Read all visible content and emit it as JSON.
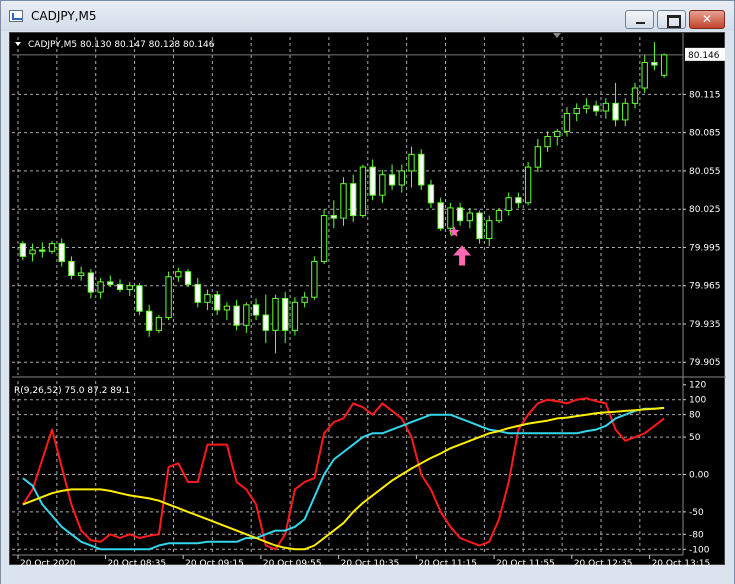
{
  "window": {
    "title": "CADJPY,M5",
    "close_glyph": "✕"
  },
  "chart_header": "CADJPY,M5  80.130 80.147 80.128 80.146",
  "indicator_header": "R(9,26,52) 75.0 87.2 89.1",
  "price_badge": "80.146",
  "colors": {
    "background": "#000000",
    "bull": "#66ff33",
    "bear": "#66ff33",
    "red_line": "#ff1a1a",
    "cyan_line": "#33d6ea",
    "yellow_line": "#ffee00",
    "marker": "#ff69b4"
  },
  "chart_data": [
    {
      "type": "candlestick",
      "symbol": "CADJPY",
      "timeframe": "M5",
      "ylim": [
        79.895,
        80.16
      ],
      "y_ticks": [
        "80.115",
        "80.085",
        "80.055",
        "80.025",
        "79.995",
        "79.965",
        "79.935",
        "79.905"
      ],
      "last_price": "80.146",
      "ohlc_header": {
        "open": 80.13,
        "high": 80.147,
        "low": 80.128,
        "close": 80.146
      },
      "candles": [
        [
          79.998,
          80.0,
          79.985,
          79.988
        ],
        [
          79.99,
          79.998,
          79.984,
          79.993
        ],
        [
          79.993,
          79.999,
          79.987,
          79.992
        ],
        [
          79.992,
          80.0,
          79.99,
          79.998
        ],
        [
          79.998,
          80.002,
          79.98,
          79.984
        ],
        [
          79.984,
          79.988,
          79.97,
          79.973
        ],
        [
          79.973,
          79.98,
          79.969,
          79.975
        ],
        [
          79.975,
          79.978,
          79.955,
          79.96
        ],
        [
          79.96,
          79.971,
          79.955,
          79.968
        ],
        [
          79.968,
          79.973,
          79.964,
          79.966
        ],
        [
          79.966,
          79.97,
          79.96,
          79.962
        ],
        [
          79.962,
          79.968,
          79.957,
          79.965
        ],
        [
          79.965,
          79.967,
          79.942,
          79.945
        ],
        [
          79.945,
          79.95,
          79.925,
          79.93
        ],
        [
          79.93,
          79.942,
          79.928,
          79.94
        ],
        [
          79.94,
          79.976,
          79.938,
          79.972
        ],
        [
          79.972,
          79.979,
          79.968,
          79.976
        ],
        [
          79.976,
          79.978,
          79.964,
          79.966
        ],
        [
          79.966,
          79.971,
          79.948,
          79.952
        ],
        [
          79.952,
          79.962,
          79.946,
          79.958
        ],
        [
          79.958,
          79.961,
          79.942,
          79.946
        ],
        [
          79.946,
          79.952,
          79.938,
          79.949
        ],
        [
          79.949,
          79.954,
          79.93,
          79.934
        ],
        [
          79.934,
          79.952,
          79.928,
          79.95
        ],
        [
          79.95,
          79.955,
          79.938,
          79.942
        ],
        [
          79.942,
          79.958,
          79.92,
          79.93
        ],
        [
          79.93,
          79.958,
          79.912,
          79.955
        ],
        [
          79.955,
          79.96,
          79.92,
          79.93
        ],
        [
          79.93,
          79.956,
          79.926,
          79.952
        ],
        [
          79.952,
          79.96,
          79.948,
          79.956
        ],
        [
          79.956,
          79.988,
          79.954,
          79.984
        ],
        [
          79.984,
          80.025,
          79.982,
          80.02
        ],
        [
          80.02,
          80.032,
          80.01,
          80.018
        ],
        [
          80.018,
          80.05,
          80.012,
          80.045
        ],
        [
          80.045,
          80.052,
          80.015,
          80.02
        ],
        [
          80.02,
          80.06,
          80.018,
          80.058
        ],
        [
          80.058,
          80.064,
          80.032,
          80.036
        ],
        [
          80.036,
          80.056,
          80.03,
          80.052
        ],
        [
          80.052,
          80.06,
          80.04,
          80.044
        ],
        [
          80.044,
          80.06,
          80.038,
          80.055
        ],
        [
          80.055,
          80.074,
          80.042,
          80.068
        ],
        [
          80.068,
          80.072,
          80.04,
          80.044
        ],
        [
          80.044,
          80.048,
          80.026,
          80.03
        ],
        [
          80.03,
          80.034,
          80.008,
          80.01
        ],
        [
          80.01,
          80.03,
          80.005,
          80.026
        ],
        [
          80.026,
          80.03,
          80.012,
          80.016
        ],
        [
          80.016,
          80.026,
          80.01,
          80.022
        ],
        [
          80.022,
          80.024,
          79.998,
          80.002
        ],
        [
          80.002,
          80.02,
          79.996,
          80.016
        ],
        [
          80.016,
          80.026,
          80.014,
          80.024
        ],
        [
          80.024,
          80.038,
          80.02,
          80.034
        ],
        [
          80.034,
          80.038,
          80.026,
          80.03
        ],
        [
          80.03,
          80.062,
          80.028,
          80.058
        ],
        [
          80.058,
          80.08,
          80.054,
          80.074
        ],
        [
          80.074,
          80.086,
          80.07,
          80.082
        ],
        [
          80.082,
          80.088,
          80.075,
          80.086
        ],
        [
          80.086,
          80.105,
          80.082,
          80.1
        ],
        [
          80.1,
          80.108,
          80.094,
          80.104
        ],
        [
          80.104,
          80.112,
          80.1,
          80.106
        ],
        [
          80.106,
          80.11,
          80.098,
          80.102
        ],
        [
          80.102,
          80.112,
          80.096,
          80.108
        ],
        [
          80.108,
          80.124,
          80.09,
          80.095
        ],
        [
          80.095,
          80.112,
          80.09,
          80.108
        ],
        [
          80.108,
          80.124,
          80.104,
          80.12
        ],
        [
          80.12,
          80.146,
          80.116,
          80.14
        ],
        [
          80.14,
          80.156,
          80.134,
          80.138
        ],
        [
          80.13,
          80.147,
          80.128,
          80.146
        ]
      ],
      "markers": [
        {
          "type": "star",
          "candle_index": 45,
          "price": 80.004
        },
        {
          "type": "up-arrow",
          "candle_index": 45,
          "price": 79.995
        }
      ]
    },
    {
      "type": "line",
      "name": "R(9,26,52)",
      "ylim": [
        -105,
        125
      ],
      "y_ticks": [
        120,
        100,
        80,
        50,
        0,
        -50,
        -80,
        -100
      ],
      "y_tick_labels": [
        "120",
        "100",
        "80",
        "50",
        "0.00",
        "-50",
        "-80",
        "-100"
      ],
      "x_tick_labels": [
        "20 Oct 2020",
        "20 Oct 08:35",
        "20 Oct 09:15",
        "20 Oct 09:55",
        "20 Oct 10:35",
        "20 Oct 11:15",
        "20 Oct 11:55",
        "20 Oct 12:35",
        "20 Oct 13:15"
      ],
      "x_tick_candle_index": [
        0,
        9,
        17,
        25,
        33,
        41,
        49,
        57,
        65
      ],
      "current_values": [
        "75.0",
        "87.2",
        "89.1"
      ],
      "series": [
        {
          "color": "red",
          "values": [
            -40,
            -20,
            20,
            60,
            10,
            -40,
            -75,
            -88,
            -90,
            -80,
            -85,
            -80,
            -85,
            -82,
            -80,
            10,
            15,
            -10,
            -10,
            40,
            40,
            40,
            -10,
            -20,
            -40,
            -95,
            -100,
            -80,
            -20,
            -10,
            -5,
            55,
            70,
            75,
            95,
            90,
            80,
            95,
            85,
            75,
            50,
            0,
            -20,
            -50,
            -70,
            -85,
            -90,
            -95,
            -90,
            -60,
            -10,
            60,
            80,
            95,
            100,
            98,
            95,
            100,
            102,
            98,
            95,
            60,
            45,
            50,
            55,
            65,
            75
          ]
        },
        {
          "color": "cyan",
          "values": [
            -5,
            -15,
            -40,
            -55,
            -70,
            -80,
            -90,
            -95,
            -100,
            -100,
            -100,
            -100,
            -100,
            -100,
            -95,
            -92,
            -92,
            -92,
            -92,
            -90,
            -90,
            -90,
            -90,
            -85,
            -85,
            -80,
            -75,
            -75,
            -70,
            -60,
            -30,
            0,
            20,
            30,
            40,
            50,
            55,
            55,
            60,
            65,
            70,
            75,
            80,
            80,
            80,
            75,
            70,
            65,
            60,
            58,
            55,
            55,
            55,
            55,
            55,
            55,
            55,
            55,
            58,
            60,
            65,
            75,
            80,
            85,
            88,
            88,
            89
          ]
        },
        {
          "color": "yellow",
          "values": [
            -40,
            -35,
            -30,
            -25,
            -22,
            -20,
            -20,
            -20,
            -20,
            -22,
            -25,
            -28,
            -30,
            -32,
            -35,
            -40,
            -45,
            -50,
            -55,
            -60,
            -65,
            -70,
            -75,
            -80,
            -85,
            -90,
            -95,
            -98,
            -100,
            -100,
            -95,
            -85,
            -75,
            -65,
            -50,
            -38,
            -28,
            -18,
            -8,
            0,
            8,
            15,
            22,
            28,
            35,
            40,
            45,
            50,
            55,
            58,
            62,
            65,
            68,
            70,
            72,
            75,
            76,
            78,
            80,
            82,
            83,
            84,
            85,
            86,
            87,
            88,
            89
          ]
        }
      ]
    }
  ]
}
